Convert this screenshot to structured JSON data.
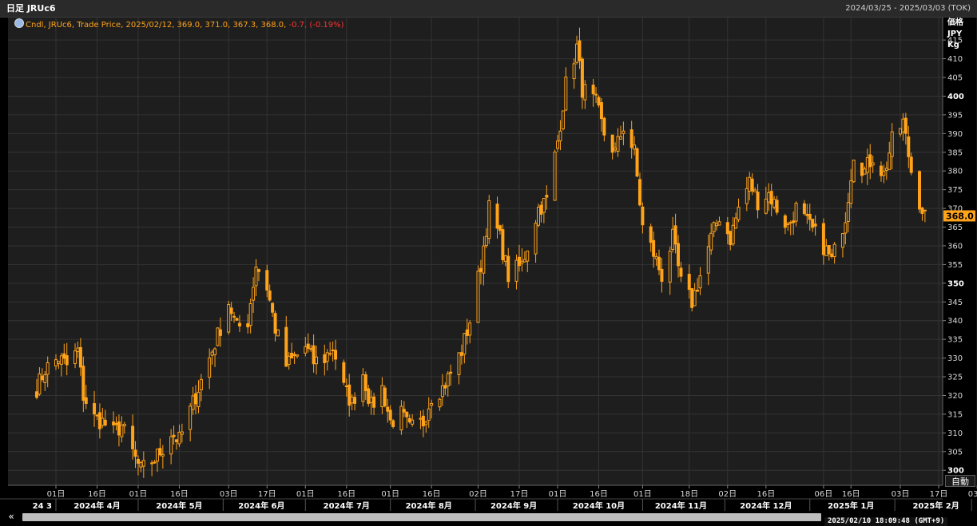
{
  "header": {
    "title": "日足 JRUc6",
    "range": "2024/03/25 - 2025/03/03 (TOK)"
  },
  "legend": {
    "main": "Cndl, JRUc6, Trade Price, 2025/02/12, 369.0, 371.0, 367.3, 368.0,",
    "change": " -0.7, (-0.19%)"
  },
  "y_units": [
    "価格",
    "JPY",
    "Kg"
  ],
  "last_price": "368.0",
  "scale_mode": "自動",
  "scroll_left_label": "«",
  "timestamp": "2025/02/10 18:09:48 (GMT+9)",
  "colors": {
    "background": "#1e1e1e",
    "grid": "#333333",
    "candle": "#ffa31a",
    "last_price_box": "#ffa31a"
  },
  "chart_data": {
    "type": "candlestick",
    "ylim": [
      296,
      421
    ],
    "y_ticks": [
      300,
      305,
      310,
      315,
      320,
      325,
      330,
      335,
      340,
      345,
      350,
      355,
      360,
      365,
      370,
      375,
      380,
      385,
      390,
      395,
      400,
      405,
      410,
      415
    ],
    "y_major_ticks": [
      300,
      350,
      400
    ],
    "x_ticks": [
      {
        "label": "01日",
        "date": "2024-04-01"
      },
      {
        "label": "16日",
        "date": "2024-04-16"
      },
      {
        "label": "01日",
        "date": "2024-05-01"
      },
      {
        "label": "16日",
        "date": "2024-05-16"
      },
      {
        "label": "03日",
        "date": "2024-06-03"
      },
      {
        "label": "17日",
        "date": "2024-06-17"
      },
      {
        "label": "01日",
        "date": "2024-07-01"
      },
      {
        "label": "16日",
        "date": "2024-07-16"
      },
      {
        "label": "01日",
        "date": "2024-08-01"
      },
      {
        "label": "16日",
        "date": "2024-08-16"
      },
      {
        "label": "02日",
        "date": "2024-09-02"
      },
      {
        "label": "17日",
        "date": "2024-09-17"
      },
      {
        "label": "01日",
        "date": "2024-10-01"
      },
      {
        "label": "16日",
        "date": "2024-10-16"
      },
      {
        "label": "01日",
        "date": "2024-11-01"
      },
      {
        "label": "18日",
        "date": "2024-11-18"
      },
      {
        "label": "02日",
        "date": "2024-12-02"
      },
      {
        "label": "16日",
        "date": "2024-12-16"
      },
      {
        "label": "06日",
        "date": "2025-01-06"
      },
      {
        "label": "16日",
        "date": "2025-01-16"
      },
      {
        "label": "03日",
        "date": "2025-02-03"
      },
      {
        "label": "17日",
        "date": "2025-02-17"
      },
      {
        "label": "03日",
        "date": "2025-03-03"
      }
    ],
    "month_labels": [
      {
        "label": "24 3",
        "date": "2024-03-27"
      },
      {
        "label": "2024年 4月",
        "date": "2024-04-16"
      },
      {
        "label": "2024年 5月",
        "date": "2024-05-16"
      },
      {
        "label": "2024年 6月",
        "date": "2024-06-15"
      },
      {
        "label": "2024年 7月",
        "date": "2024-07-16"
      },
      {
        "label": "2024年 8月",
        "date": "2024-08-15"
      },
      {
        "label": "2024年 9月",
        "date": "2024-09-15"
      },
      {
        "label": "2024年 10月",
        "date": "2024-10-16"
      },
      {
        "label": "2024年 11月",
        "date": "2024-11-15"
      },
      {
        "label": "2024年 12月",
        "date": "2024-12-16"
      },
      {
        "label": "2025年 1月",
        "date": "2025-01-16"
      },
      {
        "label": "2025年 2月",
        "date": "2025-02-16"
      }
    ],
    "month_separators": [
      "2024-04-01",
      "2024-05-01",
      "2024-06-01",
      "2024-07-01",
      "2024-08-01",
      "2024-09-01",
      "2024-10-01",
      "2024-11-01",
      "2024-12-01",
      "2025-01-01",
      "2025-02-01",
      "2025-03-01"
    ],
    "close_path": [
      [
        "2024-03-25",
        322
      ],
      [
        "2024-03-28",
        327
      ],
      [
        "2024-04-02",
        330
      ],
      [
        "2024-04-05",
        328
      ],
      [
        "2024-04-09",
        332
      ],
      [
        "2024-04-11",
        320
      ],
      [
        "2024-04-15",
        314
      ],
      [
        "2024-04-18",
        313
      ],
      [
        "2024-04-22",
        310
      ],
      [
        "2024-04-25",
        312
      ],
      [
        "2024-04-30",
        303
      ],
      [
        "2024-05-02",
        300
      ],
      [
        "2024-05-07",
        303
      ],
      [
        "2024-05-10",
        306
      ],
      [
        "2024-05-13",
        310
      ],
      [
        "2024-05-16",
        308
      ],
      [
        "2024-05-20",
        316
      ],
      [
        "2024-05-23",
        322
      ],
      [
        "2024-05-27",
        330
      ],
      [
        "2024-05-30",
        336
      ],
      [
        "2024-06-03",
        345
      ],
      [
        "2024-06-06",
        338
      ],
      [
        "2024-06-10",
        340
      ],
      [
        "2024-06-13",
        355
      ],
      [
        "2024-06-17",
        349
      ],
      [
        "2024-06-20",
        338
      ],
      [
        "2024-06-24",
        328
      ],
      [
        "2024-06-27",
        330
      ],
      [
        "2024-07-01",
        333
      ],
      [
        "2024-07-04",
        329
      ],
      [
        "2024-07-08",
        330
      ],
      [
        "2024-07-11",
        333
      ],
      [
        "2024-07-15",
        322
      ],
      [
        "2024-07-18",
        318
      ],
      [
        "2024-07-22",
        326
      ],
      [
        "2024-07-25",
        317
      ],
      [
        "2024-07-29",
        322
      ],
      [
        "2024-08-01",
        313
      ],
      [
        "2024-08-05",
        315
      ],
      [
        "2024-08-08",
        311
      ],
      [
        "2024-08-13",
        313
      ],
      [
        "2024-08-16",
        320
      ],
      [
        "2024-08-20",
        322
      ],
      [
        "2024-08-23",
        326
      ],
      [
        "2024-08-27",
        332
      ],
      [
        "2024-08-30",
        340
      ],
      [
        "2024-09-03",
        355
      ],
      [
        "2024-09-06",
        370
      ],
      [
        "2024-09-10",
        362
      ],
      [
        "2024-09-13",
        352
      ],
      [
        "2024-09-18",
        355
      ],
      [
        "2024-09-20",
        360
      ],
      [
        "2024-09-24",
        370
      ],
      [
        "2024-09-27",
        372
      ],
      [
        "2024-10-01",
        388
      ],
      [
        "2024-10-04",
        403
      ],
      [
        "2024-10-08",
        413
      ],
      [
        "2024-10-10",
        402
      ],
      [
        "2024-10-15",
        398
      ],
      [
        "2024-10-18",
        390
      ],
      [
        "2024-10-22",
        385
      ],
      [
        "2024-10-25",
        392
      ],
      [
        "2024-10-29",
        385
      ],
      [
        "2024-11-01",
        365
      ],
      [
        "2024-11-05",
        358
      ],
      [
        "2024-11-08",
        352
      ],
      [
        "2024-11-12",
        362
      ],
      [
        "2024-11-15",
        350
      ],
      [
        "2024-11-19",
        345
      ],
      [
        "2024-11-22",
        352
      ],
      [
        "2024-11-26",
        362
      ],
      [
        "2024-11-29",
        368
      ],
      [
        "2024-12-03",
        362
      ],
      [
        "2024-12-06",
        370
      ],
      [
        "2024-12-10",
        377
      ],
      [
        "2024-12-13",
        372
      ],
      [
        "2024-12-17",
        374
      ],
      [
        "2024-12-20",
        370
      ],
      [
        "2024-12-24",
        365
      ],
      [
        "2024-12-27",
        370
      ],
      [
        "2025-01-06",
        360
      ],
      [
        "2025-01-09",
        356
      ],
      [
        "2025-01-14",
        368
      ],
      [
        "2025-01-17",
        385
      ],
      [
        "2025-01-21",
        380
      ],
      [
        "2025-01-24",
        384
      ],
      [
        "2025-01-28",
        379
      ],
      [
        "2025-01-31",
        388
      ],
      [
        "2025-02-04",
        393
      ],
      [
        "2025-02-07",
        380
      ],
      [
        "2025-02-10",
        372
      ],
      [
        "2025-02-12",
        368
      ]
    ]
  }
}
